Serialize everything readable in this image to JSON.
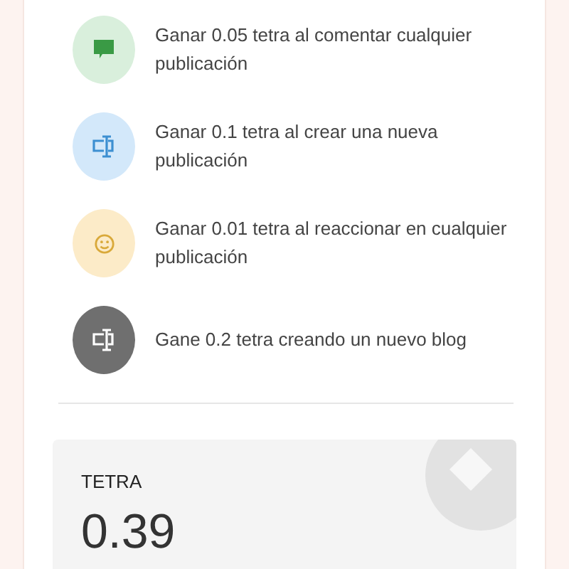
{
  "rewards": [
    {
      "kind": "comment",
      "color": "#d9efdc",
      "text": "Ganar 0.05 tetra al comentar cualquier publicación"
    },
    {
      "kind": "post",
      "color": "#d3e8fa",
      "text": "Ganar 0.1 tetra al crear una nueva publicación"
    },
    {
      "kind": "reaction",
      "color": "#fcebc8",
      "text": "Ganar 0.01 tetra al reaccionar en cualquier publicación"
    },
    {
      "kind": "blog",
      "color": "#6f6f6f",
      "text": "Gane 0.2 tetra creando un nuevo blog"
    }
  ],
  "balance": {
    "label": "TETRA",
    "value": "0.39"
  }
}
